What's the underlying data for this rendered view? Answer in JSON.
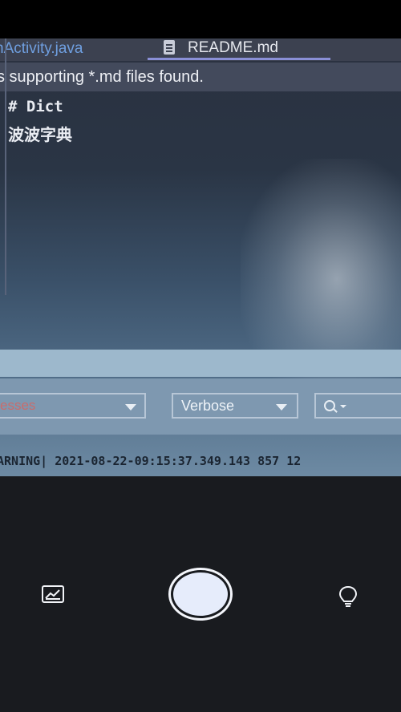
{
  "ide": {
    "tabs": [
      {
        "label": "nActivity.java"
      },
      {
        "label": "README.md"
      }
    ],
    "notice": "s supporting *.md files found.",
    "editor_lines": [
      "# Dict",
      "波波字典"
    ]
  },
  "logcat": {
    "process_select": "esses",
    "level_select": "Verbose",
    "log_line": "ARNING| 2021-08-22-09:15:37.349.143 857 12"
  },
  "camera": {
    "gallery_icon": "gallery-icon",
    "shutter_icon": "shutter-button",
    "flash_icon": "lightbulb-icon"
  }
}
